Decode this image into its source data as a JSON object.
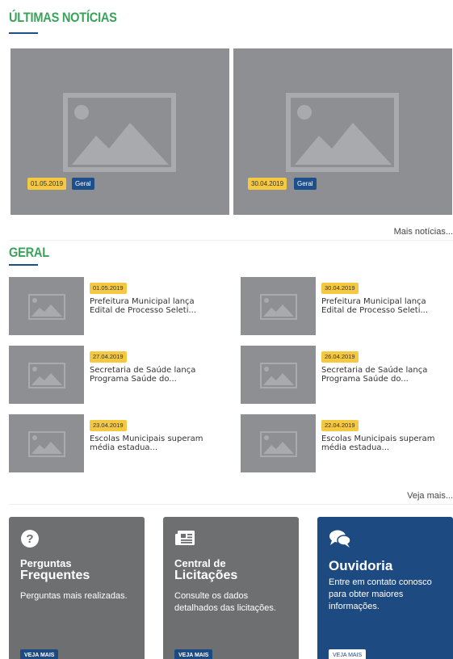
{
  "latest": {
    "title": "ÚLTIMAS NOTÍCIAS",
    "slides": [
      {
        "date": "01.05.2019",
        "category": "Geral"
      },
      {
        "date": "30.04.2019",
        "category": "Geral"
      }
    ],
    "more_label": "Mais notícias..."
  },
  "geral": {
    "title": "GERAL",
    "items": [
      {
        "date": "01.05.2019",
        "title": "Prefeitura Municipal lança Edital de Processo Seleti..."
      },
      {
        "date": "30.04.2019",
        "title": "Prefeitura Municipal lança Edital de Processo Seleti..."
      },
      {
        "date": "27.04.2019",
        "title": "Secretaria de Saúde lança Programa Saúde do..."
      },
      {
        "date": "26.04.2019",
        "title": "Secretaria de Saúde lança Programa Saúde do..."
      },
      {
        "date": "23.04.2019",
        "title": "Escolas Municipais superam média estadua..."
      },
      {
        "date": "22.04.2019",
        "title": "Escolas Municipais superam média estadua..."
      }
    ],
    "more_label": "Veja mais..."
  },
  "cards": [
    {
      "title_line1": "Perguntas",
      "title_line2": "Frequentes",
      "text": "Perguntas mais realizadas.",
      "button": "VEJA MAIS",
      "icon": "question-circle-icon",
      "color": "#6e6f71"
    },
    {
      "title_line1": "Central de",
      "title_line2": "Licitações",
      "text": "Consulte os dados detalhados das licitações.",
      "button": "VEJA MAIS",
      "icon": "newspaper-icon",
      "color": "#6e6f71"
    },
    {
      "title_line1": "Ouvidoria",
      "text": "Entre em contato conosco para obter maiores informações.",
      "button": "VEJA MAIS",
      "icon": "chat-bubbles-icon",
      "color": "#1d4a80"
    }
  ],
  "colors": {
    "accent_green": "#3aa35a",
    "accent_blue": "#1d4f8b",
    "badge_yellow": "#f5c842",
    "placeholder_gray": "#8e8f92"
  }
}
